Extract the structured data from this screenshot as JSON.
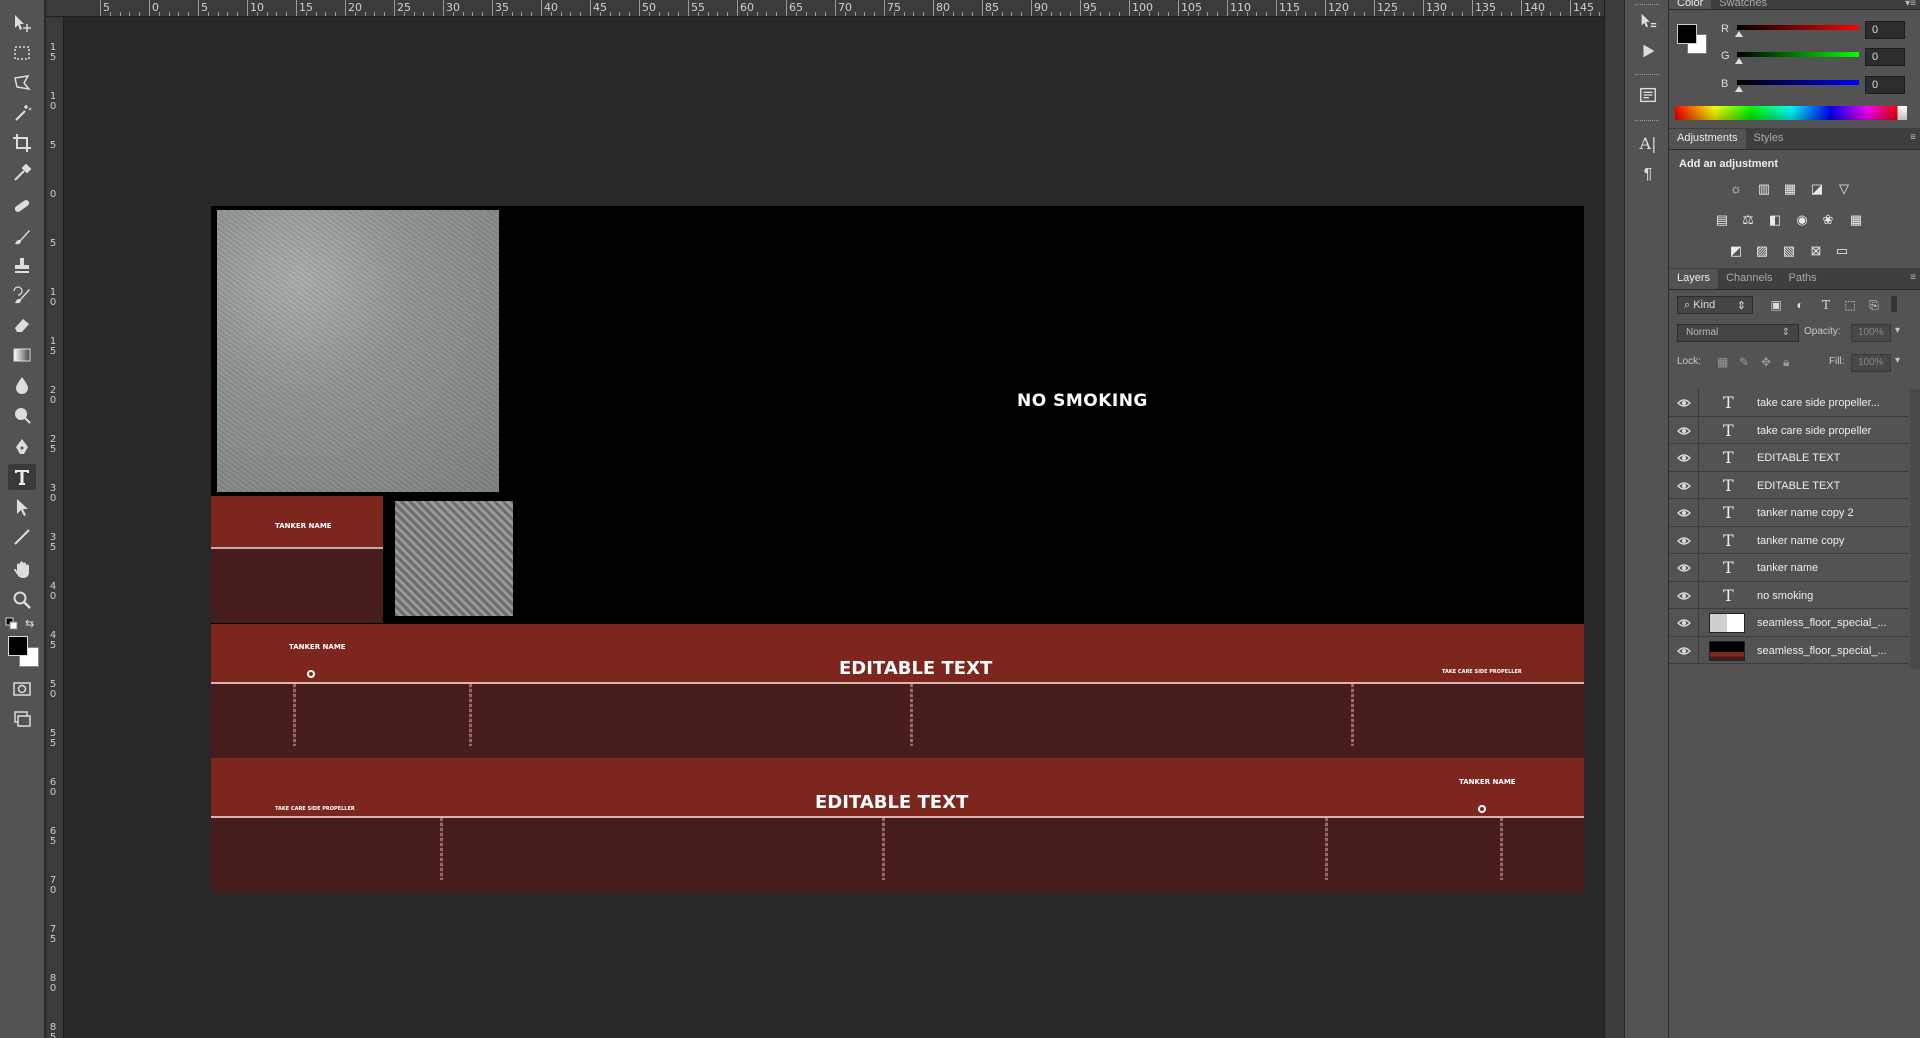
{
  "toolbar": {
    "tools": [
      {
        "name": "move-tool",
        "icon": "move-icon"
      },
      {
        "name": "marquee-tool",
        "icon": "marquee-icon"
      },
      {
        "name": "lasso-tool",
        "icon": "lasso-icon"
      },
      {
        "name": "magic-wand-tool",
        "icon": "magic-wand-icon"
      },
      {
        "name": "crop-tool",
        "icon": "crop-icon"
      },
      {
        "name": "eyedropper-tool",
        "icon": "eyedropper-icon"
      },
      {
        "name": "healing-tool",
        "icon": "bandage-icon"
      },
      {
        "name": "brush-tool",
        "icon": "brush-icon"
      },
      {
        "name": "stamp-tool",
        "icon": "stamp-icon"
      },
      {
        "name": "history-brush-tool",
        "icon": "history-brush-icon"
      },
      {
        "name": "eraser-tool",
        "icon": "eraser-icon"
      },
      {
        "name": "gradient-tool",
        "icon": "gradient-icon"
      },
      {
        "name": "blur-tool",
        "icon": "drop-icon"
      },
      {
        "name": "dodge-tool",
        "icon": "dodge-icon"
      },
      {
        "name": "pen-tool",
        "icon": "pen-icon"
      },
      {
        "name": "type-tool",
        "icon": "type-icon"
      },
      {
        "name": "path-selection-tool",
        "icon": "arrow-icon"
      },
      {
        "name": "line-tool",
        "icon": "line-icon"
      },
      {
        "name": "hand-tool",
        "icon": "hand-icon"
      },
      {
        "name": "zoom-tool",
        "icon": "magnifier-icon"
      }
    ],
    "active_tool": "type-tool"
  },
  "ruler": {
    "horizontal": [
      "5",
      "0",
      "5",
      "10",
      "15",
      "20",
      "25",
      "30",
      "35",
      "40",
      "45",
      "50",
      "55",
      "60",
      "65",
      "70",
      "75",
      "80",
      "85",
      "90",
      "95",
      "100",
      "105",
      "110",
      "115",
      "120",
      "125",
      "130",
      "135",
      "140",
      "145"
    ],
    "vertical": [
      "1 5",
      "1 0",
      "5",
      "0",
      "5",
      "1 0",
      "1 5",
      "2 0",
      "2 5",
      "3 0",
      "3 5",
      "4 0",
      "4 5",
      "5 0",
      "5 5",
      "6 0",
      "6 5",
      "7 0",
      "7 5",
      "8 0",
      "8 5"
    ]
  },
  "canvas": {
    "no_smoking": "NO SMOKING",
    "label_small_title": "TANKER NAME",
    "band1": {
      "left_label": "TANKER NAME",
      "center": "EDITABLE TEXT",
      "right_label": "TAKE CARE SIDE PROPELLER"
    },
    "band2": {
      "left_label": "TAKE CARE SIDE PROPELLER",
      "center": "EDITABLE TEXT",
      "right_label": "TANKER NAME"
    },
    "colors": {
      "red": "#7d261e",
      "dark_red": "#461c1c",
      "background": "#000000"
    }
  },
  "color_panel": {
    "tabs": [
      "Color",
      "Swatches"
    ],
    "r_label": "R",
    "g_label": "G",
    "b_label": "B",
    "r_value": "0",
    "g_value": "0",
    "b_value": "0"
  },
  "adjustments_panel": {
    "tabs": [
      "Adjustments",
      "Styles"
    ],
    "title": "Add an adjustment"
  },
  "layers_panel": {
    "tabs": [
      "Layers",
      "Channels",
      "Paths"
    ],
    "kind": "Kind",
    "blend_mode": "Normal",
    "opacity_label": "Opacity:",
    "opacity_value": "100%",
    "lock_label": "Lock:",
    "fill_label": "Fill:",
    "fill_value": "100%",
    "layers": [
      {
        "type": "text",
        "name": "take care side propeller..."
      },
      {
        "type": "text",
        "name": "take care side propeller"
      },
      {
        "type": "text",
        "name": "EDITABLE TEXT"
      },
      {
        "type": "text",
        "name": "EDITABLE TEXT"
      },
      {
        "type": "text",
        "name": "tanker name copy 2"
      },
      {
        "type": "text",
        "name": "tanker name copy"
      },
      {
        "type": "text",
        "name": "tanker name"
      },
      {
        "type": "text",
        "name": "no smoking"
      },
      {
        "type": "image",
        "name": "seamless_floor_special_..."
      },
      {
        "type": "image",
        "name": "seamless_floor_special_..."
      }
    ]
  }
}
